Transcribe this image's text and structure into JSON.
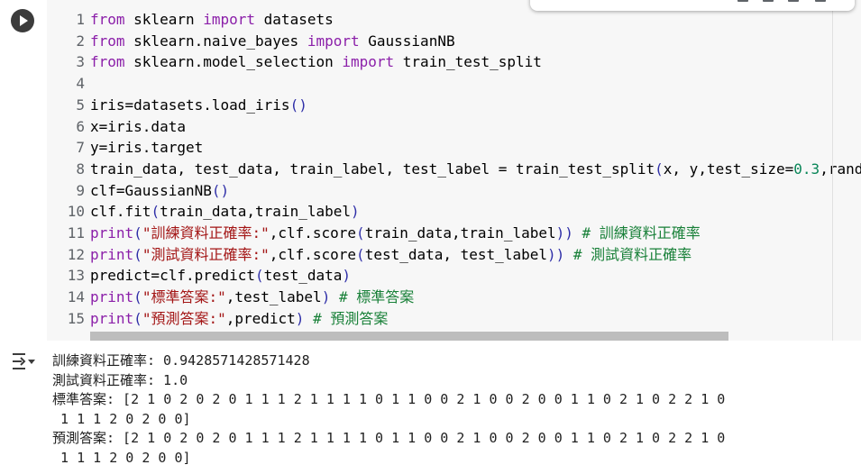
{
  "code_lines": [
    {
      "n": "1",
      "html": [
        [
          "kw",
          "from"
        ],
        [
          "",
          " sklearn "
        ],
        [
          "kw",
          "import"
        ],
        [
          "",
          " datasets"
        ]
      ]
    },
    {
      "n": "2",
      "html": [
        [
          "kw",
          "from"
        ],
        [
          "",
          " sklearn.naive_bayes "
        ],
        [
          "kw",
          "import"
        ],
        [
          "",
          " GaussianNB"
        ]
      ]
    },
    {
      "n": "3",
      "html": [
        [
          "kw",
          "from"
        ],
        [
          "",
          " sklearn.model_selection "
        ],
        [
          "kw",
          "import"
        ],
        [
          "",
          " train_test_split"
        ]
      ]
    },
    {
      "n": "4",
      "html": []
    },
    {
      "n": "5",
      "html": [
        [
          "",
          "iris=datasets.load_iris"
        ],
        [
          "fn",
          "()"
        ]
      ]
    },
    {
      "n": "6",
      "html": [
        [
          "",
          "x=iris.data"
        ]
      ]
    },
    {
      "n": "7",
      "html": [
        [
          "",
          "y=iris.target"
        ]
      ]
    },
    {
      "n": "8",
      "html": [
        [
          "",
          "train_data, test_data, train_label, test_label = train_test_split"
        ],
        [
          "fn",
          "("
        ],
        [
          "",
          "x, y,test_size="
        ],
        [
          "num",
          "0.3"
        ],
        [
          "",
          ",rand"
        ]
      ]
    },
    {
      "n": "9",
      "html": [
        [
          "",
          "clf=GaussianNB"
        ],
        [
          "fn",
          "()"
        ]
      ]
    },
    {
      "n": "10",
      "html": [
        [
          "",
          "clf.fit"
        ],
        [
          "fn",
          "("
        ],
        [
          "",
          "train_data,train_label"
        ],
        [
          "fn",
          ")"
        ]
      ]
    },
    {
      "n": "11",
      "html": [
        [
          "kw",
          "print"
        ],
        [
          "fn",
          "("
        ],
        [
          "str",
          "\"訓練資料正確率:\""
        ],
        [
          "",
          ",clf.score"
        ],
        [
          "fn",
          "("
        ],
        [
          "",
          "train_data,train_label"
        ],
        [
          "fn",
          "))"
        ],
        [
          "",
          " "
        ],
        [
          "cm",
          "# 訓練資料正確率"
        ]
      ]
    },
    {
      "n": "12",
      "html": [
        [
          "kw",
          "print"
        ],
        [
          "fn",
          "("
        ],
        [
          "str",
          "\"測試資料正確率:\""
        ],
        [
          "",
          ",clf.score"
        ],
        [
          "fn",
          "("
        ],
        [
          "",
          "test_data, test_label"
        ],
        [
          "fn",
          "))"
        ],
        [
          "",
          " "
        ],
        [
          "cm",
          "# 測試資料正確率"
        ]
      ]
    },
    {
      "n": "13",
      "html": [
        [
          "",
          "predict=clf.predict"
        ],
        [
          "fn",
          "("
        ],
        [
          "",
          "test_data"
        ],
        [
          "fn",
          ")"
        ]
      ]
    },
    {
      "n": "14",
      "html": [
        [
          "kw",
          "print"
        ],
        [
          "fn",
          "("
        ],
        [
          "str",
          "\"標準答案:\""
        ],
        [
          "",
          ",test_label"
        ],
        [
          "fn",
          ")"
        ],
        [
          "",
          " "
        ],
        [
          "cm",
          "# 標準答案"
        ]
      ]
    },
    {
      "n": "15",
      "html": [
        [
          "kw",
          "print"
        ],
        [
          "fn",
          "("
        ],
        [
          "str",
          "\"預測答案:\""
        ],
        [
          "",
          ",predict"
        ],
        [
          "fn",
          ")"
        ],
        [
          "",
          " "
        ],
        [
          "cm",
          "# 預測答案"
        ]
      ]
    }
  ],
  "output": {
    "line1": "訓練資料正確率: 0.9428571428571428",
    "line2": "測試資料正確率: 1.0",
    "line3": "標準答案: [2 1 0 2 0 2 0 1 1 1 2 1 1 1 1 0 1 1 0 0 2 1 0 0 2 0 0 1 1 0 2 1 0 2 2 1 0",
    "line4": " 1 1 1 2 0 2 0 0]",
    "line5": "預測答案: [2 1 0 2 0 2 0 1 1 1 2 1 1 1 1 0 1 1 0 0 2 1 0 0 2 0 0 1 1 0 2 1 0 2 2 1 0",
    "line6": " 1 1 1 2 0 2 0 0]"
  },
  "icons": {
    "run": "play-icon",
    "output": "output-collapse-icon"
  },
  "colors": {
    "editor_bg": "#f7f7f7",
    "keyword": "#8b1fa9",
    "string": "#a31515",
    "number": "#098658",
    "comment": "#188038"
  }
}
